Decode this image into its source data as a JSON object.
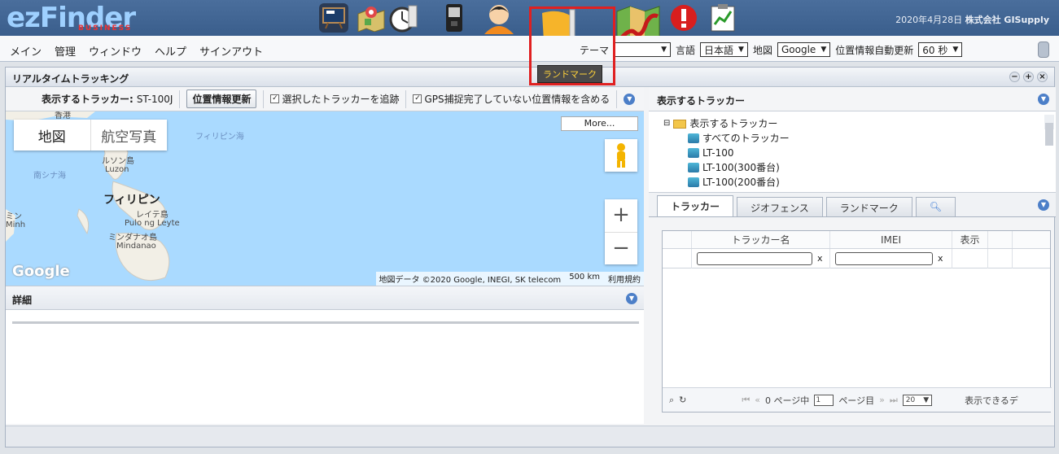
{
  "header": {
    "logo": "ezFinder",
    "logo_sub": "BUSINESS",
    "date": "2020年4月28日",
    "company": "株式会社 GISupply",
    "icons": [
      "presentation-board-icon",
      "map-pin-icon",
      "stopwatch-icon",
      "phone-device-icon",
      "user-icon",
      "landmark-flag-icon",
      "route-map-icon",
      "alert-icon",
      "report-chart-icon"
    ]
  },
  "menubar": {
    "items": [
      "メイン",
      "管理",
      "ウィンドウ",
      "ヘルプ",
      "サインアウト"
    ],
    "theme_label": "テーマ",
    "lang_label": "言語",
    "lang_value": "日本語",
    "map_label": "地図",
    "map_value": "Google",
    "refresh_label": "位置情報自動更新",
    "refresh_value": "60 秒"
  },
  "tooltip": "ランドマーク",
  "main": {
    "title": "リアルタイムトラッキング",
    "tracker_label": "表示するトラッカー:",
    "tracker_value": "ST-100J",
    "update_button": "位置情報更新",
    "follow_check": "選択したトラッカーを追跡",
    "gps_check": "GPS捕捉完了していない位置情報を含める"
  },
  "map": {
    "btn_map": "地図",
    "btn_satellite": "航空写真",
    "more": "More...",
    "labels": {
      "hongkong": "香港",
      "philippine_sea": "フィリピン海",
      "south_china_sea": "南シナ海",
      "luzon_jp": "ルソン島",
      "luzon_en": "Luzon",
      "philippines": "フィリピン",
      "leyte_jp": "レイテ島",
      "leyte_en": "Pulo ng Leyte",
      "mindanao_jp": "ミンダナオ島",
      "mindanao_en": "Mindanao",
      "left_edge_1": "ミン",
      "left_edge_2": "Minh"
    },
    "google": "Google",
    "attribution": "地図データ ©2020 Google, INEGI, SK telecom",
    "scale": "500 km",
    "terms": "利用規約"
  },
  "detail": {
    "title": "詳細"
  },
  "right": {
    "title": "表示するトラッカー",
    "tree_root": "表示するトラッカー",
    "tree_items": [
      "すべてのトラッカー",
      "LT-100",
      "LT-100(300番台)",
      "LT-100(200番台)"
    ],
    "tabs": [
      "トラッカー",
      "ジオフェンス",
      "ランドマーク"
    ],
    "columns": [
      "トラッカー名",
      "IMEI",
      "表示"
    ],
    "pager": {
      "page_text_1": "0 ページ中",
      "page_value": "1",
      "page_text_2": "ページ目",
      "page_size": "20",
      "empty_text": "表示できるデ"
    }
  }
}
